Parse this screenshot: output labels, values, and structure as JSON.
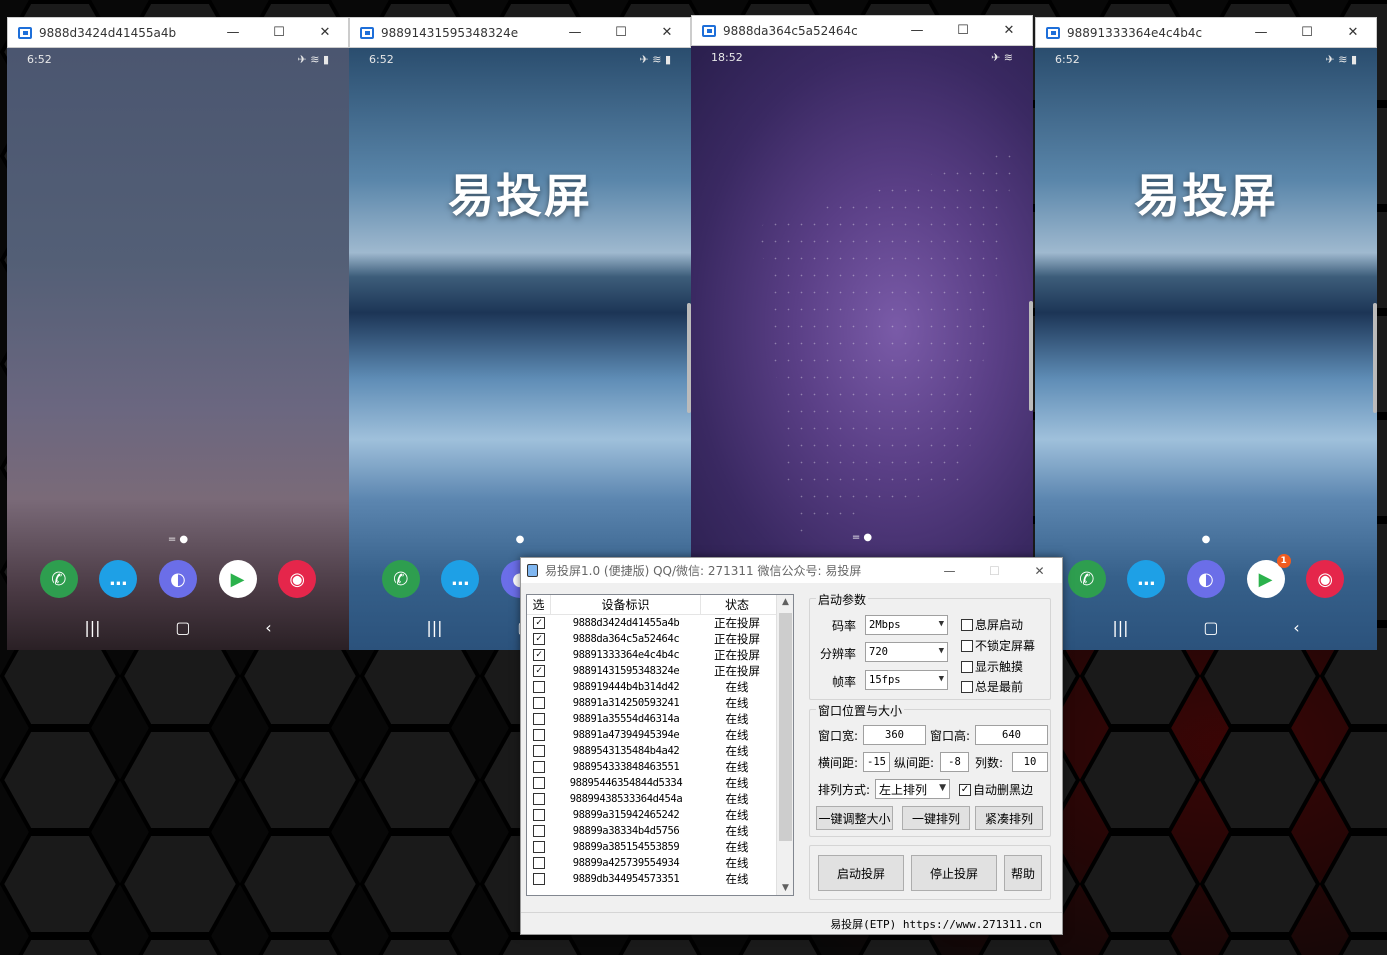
{
  "windows": [
    {
      "title": "9888d3424d41455a4b",
      "status_time": "6:52",
      "screen": "dusk"
    },
    {
      "title": "98891431595348324e",
      "status_time": "6:52",
      "screen": "dunes",
      "brand": "易投屏"
    },
    {
      "title": "9888da364c5a52464c",
      "status_time": "18:52",
      "screen": "purple"
    },
    {
      "title": "98891333364e4c4b4c",
      "status_time": "6:52",
      "screen": "dunes",
      "brand": "易投屏"
    }
  ],
  "window_controls": {
    "minimize": "—",
    "maximize": "☐",
    "close": "✕"
  },
  "dialog": {
    "title": "易投屏1.0 (便捷版)  QQ/微信: 271311  微信公众号: 易投屏",
    "list": {
      "headers": {
        "select": "选",
        "device": "设备标识",
        "status": "状态"
      },
      "rows": [
        {
          "checked": true,
          "id": "9888d3424d41455a4b",
          "status": "正在投屏"
        },
        {
          "checked": true,
          "id": "9888da364c5a52464c",
          "status": "正在投屏"
        },
        {
          "checked": true,
          "id": "98891333364e4c4b4c",
          "status": "正在投屏"
        },
        {
          "checked": true,
          "id": "98891431595348324e",
          "status": "正在投屏"
        },
        {
          "checked": false,
          "id": "988919444b4b314d42",
          "status": "在线"
        },
        {
          "checked": false,
          "id": "98891a314250593241",
          "status": "在线"
        },
        {
          "checked": false,
          "id": "98891a35554d46314a",
          "status": "在线"
        },
        {
          "checked": false,
          "id": "98891a47394945394e",
          "status": "在线"
        },
        {
          "checked": false,
          "id": "9889543135484b4a42",
          "status": "在线"
        },
        {
          "checked": false,
          "id": "988954333848463551",
          "status": "在线"
        },
        {
          "checked": false,
          "id": "98895446354844d5334",
          "status": "在线"
        },
        {
          "checked": false,
          "id": "98899438533364d454a",
          "status": "在线"
        },
        {
          "checked": false,
          "id": "98899a315942465242",
          "status": "在线"
        },
        {
          "checked": false,
          "id": "98899a38334b4d5756",
          "status": "在线"
        },
        {
          "checked": false,
          "id": "98899a385154553859",
          "status": "在线"
        },
        {
          "checked": false,
          "id": "98899a425739554934",
          "status": "在线"
        },
        {
          "checked": false,
          "id": "9889db344954573351",
          "status": "在线"
        }
      ]
    },
    "launch": {
      "group": "启动参数",
      "bitrate_label": "码率",
      "bitrate": "2Mbps",
      "resolution_label": "分辨率",
      "resolution": "720",
      "fps_label": "帧率",
      "fps": "15fps",
      "opt_screen_off": "息屏启动",
      "opt_no_lock": "不锁定屏幕",
      "opt_show_touch": "显示触摸",
      "opt_always_top": "总是最前"
    },
    "layout": {
      "group": "窗口位置与大小",
      "width_label": "窗口宽:",
      "width": "360",
      "height_label": "窗口高:",
      "height": "640",
      "hgap_label": "横间距:",
      "hgap": "-15",
      "vgap_label": "纵间距:",
      "vgap": "-8",
      "cols_label": "列数:",
      "cols": "10",
      "sort_label": "排列方式:",
      "sort": "左上排列",
      "auto_trim": "自动删黑边",
      "btn_resize": "一键调整大小",
      "btn_arrange": "一键排列",
      "btn_compact": "紧凑排列"
    },
    "actions": {
      "start": "启动投屏",
      "stop": "停止投屏",
      "help": "帮助"
    },
    "footer": "易投屏(ETP)  https://www.271311.cn"
  }
}
